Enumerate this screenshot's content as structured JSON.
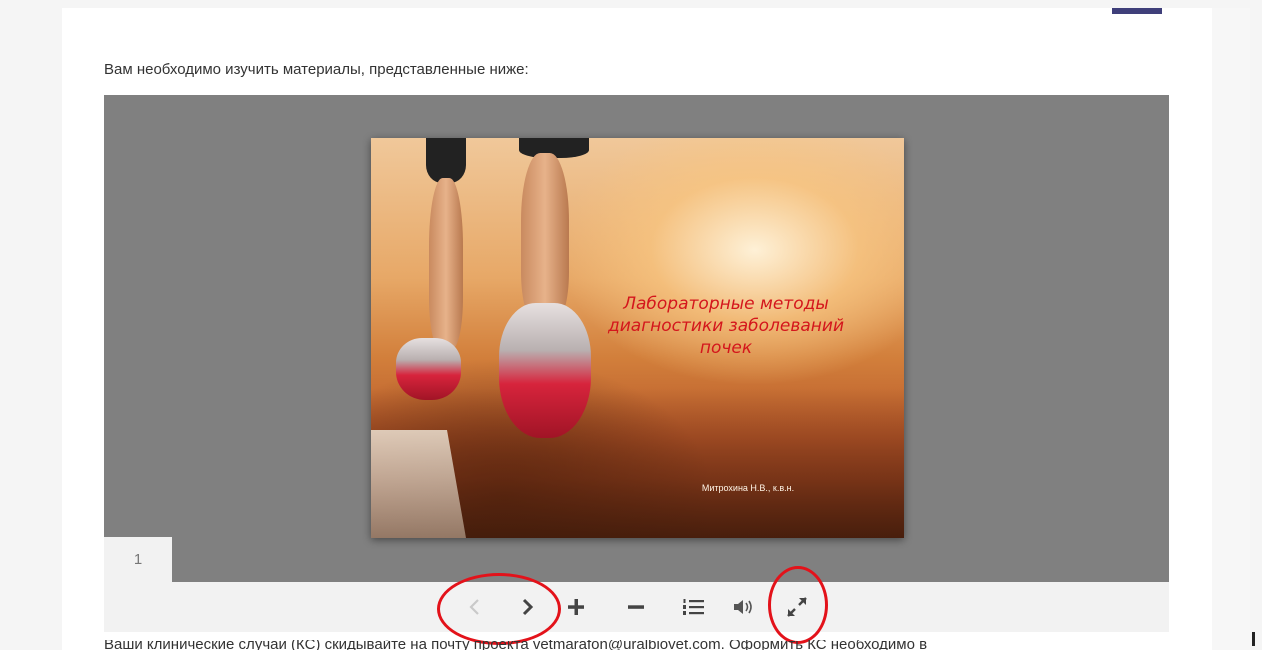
{
  "intro": {
    "text": "Вам необходимо изучить материалы, представленные ниже:"
  },
  "slide": {
    "title_lines": [
      "Лабораторные методы",
      "диагностики заболеваний",
      "почек"
    ],
    "author": "Митрохина Н.В., к.в.н."
  },
  "viewer": {
    "page_number": "1",
    "toolbar": [
      {
        "name": "prev-icon",
        "glyph": "‹",
        "enabled": false
      },
      {
        "name": "next-icon",
        "glyph": "›",
        "enabled": true
      },
      {
        "name": "zoom-in-icon",
        "glyph": "+",
        "enabled": true
      },
      {
        "name": "zoom-out-icon",
        "glyph": "−",
        "enabled": true
      },
      {
        "name": "contents-icon",
        "glyph": "list",
        "enabled": true
      },
      {
        "name": "sound-icon",
        "glyph": "speaker",
        "enabled": true
      },
      {
        "name": "fullscreen-icon",
        "glyph": "expand",
        "enabled": true
      }
    ]
  },
  "bottom": {
    "text": "Ваши клинические случаи (КС) скидывайте на почту проекта vetmarafon@uralbiovet.com. Оформить КС необходимо в"
  },
  "colors": {
    "viewer_bg": "#808080",
    "toolbar_bg": "#f2f2f2",
    "slide_title": "#d4161c",
    "callout": "#e3121a",
    "accent": "#3f3f7a"
  }
}
